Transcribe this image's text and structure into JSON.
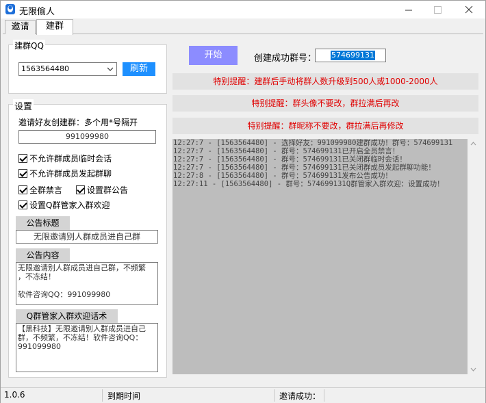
{
  "window": {
    "title": "无限偷人",
    "icons": {
      "app": "qq-penguin-icon",
      "minimize": "minimize-icon",
      "maximize": "maximize-icon",
      "close": "close-icon"
    }
  },
  "tabs": [
    {
      "label": "邀请",
      "active": false
    },
    {
      "label": "建群",
      "active": true
    }
  ],
  "group_qq": {
    "title": "建群QQ",
    "selected_qq": "1563564480",
    "refresh_label": "刷新"
  },
  "settings": {
    "title": "设置",
    "invite_label": "邀请好友创建群：多个用*号隔开",
    "invite_value": "991099980",
    "options": [
      {
        "label": "不允许群成员临时会话",
        "checked": true
      },
      {
        "label": "不允许群成员发起群聊",
        "checked": true
      },
      {
        "label": "全群禁言",
        "checked": true
      },
      {
        "label": "设置群公告",
        "checked": true
      },
      {
        "label": "设置Q群管家入群欢迎",
        "checked": true
      }
    ],
    "notice_title_label": "公告标题",
    "notice_title_value": "无限邀请别人群成员进自己群",
    "notice_content_label": "公告内容",
    "notice_content_value": "无限邀请别人群成员进自己群，不频繁\n，不冻结！\n\n软件咨询QQ：991099980",
    "welcome_label": "Q群管家入群欢迎话术",
    "welcome_value": "【黑科技】无限邀请别人群成员进自己\n群，不频繁，不冻结！软件咨询QQ：\n991099980"
  },
  "main": {
    "start_label": "开始",
    "created_group_label": "创建成功群号：",
    "created_group_value": "574699131",
    "warnings": [
      "特别提醒：建群后手动将群人数升级到500人或1000-2000人",
      "特别提醒：群头像不要改，群拉满后再改",
      "特别提醒：群昵称不要改，群拉满后再修改"
    ],
    "log": [
      "12:27:7 - [1563564480] - 选择好友：991099980建群成功！群号：574699131",
      "12:27:7 - [1563564480] - 群号：574699131已开启全员禁言！",
      "12:27:7 - [1563564480] - 群号：574699131已关闭群临时会话！",
      "12:27:7 - [1563564480] - 群号：574699131已关闭群成员发起群聊功能！",
      "12:27:8 - [1563564480] - 群号：574699131发布公告成功！",
      "12:27:11 - [1563564480] - 群号：574699131Q群管家入群欢迎：设置成功！"
    ]
  },
  "status_bar": {
    "version": "1.0.6",
    "expire_label": "到期时间",
    "invite_success_label": "邀请成功："
  },
  "colors": {
    "accent_blue": "#1e90ff",
    "start_button": "#8c8cff",
    "warning_text": "#e00000",
    "log_background": "#bdbdbd"
  }
}
